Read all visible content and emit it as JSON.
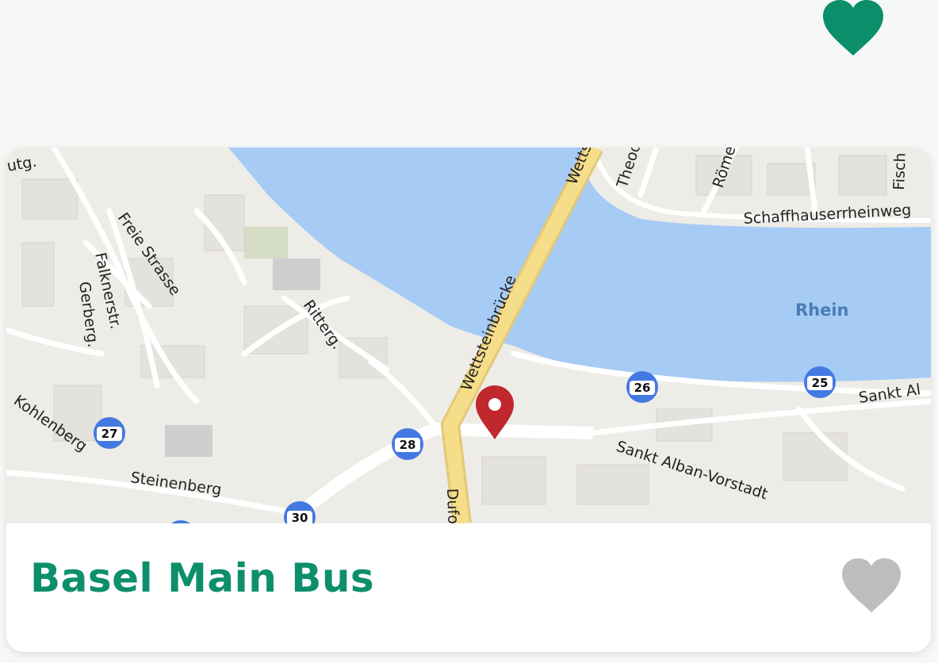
{
  "header": {
    "favorite_icon": "heart-icon",
    "favorite_color": "#0a8f6a"
  },
  "card": {
    "title": "Basel Main Bus",
    "title_color": "#0d8f6b",
    "favorite_icon": "heart-icon",
    "favorite_color": "#bdbdbd",
    "map": {
      "marker_icon": "map-pin-icon",
      "marker_color": "#c0282d",
      "water_color": "#a6cbf5",
      "street_labels": {
        "rhein": "Rhein",
        "wettsteinbruecke": "Wettsteinbrücke",
        "wetts": "Wetts",
        "theod": "Theod",
        "roeme": "Röme",
        "fisch": "Fisch",
        "schaffhauserrheinweg": "Schaffhauserrheinweg",
        "freie_strasse": "Freie Strasse",
        "falknerstr": "Falknerstr.",
        "gerberg": "Gerberg.",
        "ritterg": "Ritterg.",
        "kohlenberg": "Kohlenberg",
        "steinenberg": "Steinenberg",
        "sankt_alban_vorstadt": "Sankt Alban-Vorstadt",
        "sankt_al": "Sankt Al",
        "dufo": "Dufo",
        "utg": "utg."
      },
      "stop_badges": [
        "27",
        "28",
        "30",
        "26",
        "25"
      ]
    }
  }
}
